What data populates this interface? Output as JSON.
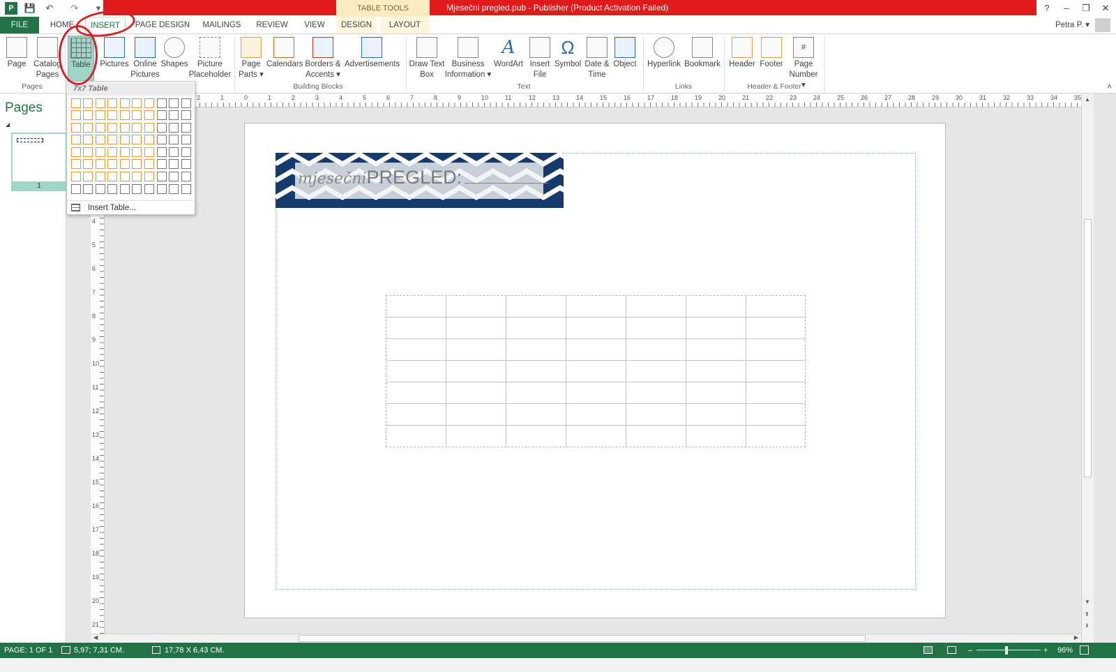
{
  "titlebar": {
    "contextual_tab": "TABLE TOOLS",
    "title": "Mjesečni pregled.pub -  Publisher (Product Activation Failed)",
    "help": "?",
    "minimize": "–",
    "restore": "❐",
    "close": "✕",
    "qat": {
      "app": "P",
      "save": "💾",
      "undo": "↶",
      "redo": "↷",
      "customize": "▾"
    }
  },
  "tabs": {
    "file": "FILE",
    "home": "HOME",
    "insert": "INSERT",
    "page_design": "PAGE DESIGN",
    "mailings": "MAILINGS",
    "review": "REVIEW",
    "view": "VIEW",
    "design": "DESIGN",
    "layout": "LAYOUT",
    "user": "Petra P. ▾"
  },
  "ribbon": {
    "page": "Page",
    "catalog_pages": "Catalog Pages",
    "table": "Table",
    "pictures": "Pictures",
    "online_pictures": "Online Pictures",
    "shapes": "Shapes",
    "picture_placeholder": "Picture Placeholder",
    "page_parts": "Page Parts ▾",
    "calendars": "Calendars",
    "borders_accents": "Borders & Accents ▾",
    "advertisements": "Advertisements",
    "draw_text_box": "Draw Text Box",
    "business_information": "Business Information ▾",
    "wordart": "WordArt",
    "insert_file": "Insert File",
    "symbol": "Symbol",
    "date_time": "Date & Time",
    "object": "Object",
    "hyperlink": "Hyperlink",
    "bookmark": "Bookmark",
    "header": "Header",
    "footer": "Footer",
    "page_number": "Page Number ▾",
    "groups": {
      "pages": "Pages",
      "building_blocks": "Building Blocks",
      "text": "Text",
      "links": "Links",
      "header_footer": "Header & Footer"
    },
    "collapse": "˄"
  },
  "left_pane": {
    "title": "Pages",
    "collapse": "◢",
    "thumb_number": "1"
  },
  "dropdown": {
    "header": "7x7 Table",
    "rows": 8,
    "cols": 10,
    "selected_rows": 7,
    "selected_cols": 7,
    "insert_table": "Insert Table..."
  },
  "document": {
    "banner_script": "mjesečni",
    "banner_text": "PREGLED:",
    "table_rows": 7,
    "table_cols": 7
  },
  "rulers": {
    "h": [
      "2",
      "1",
      "0",
      "1",
      "2",
      "3",
      "4",
      "5",
      "6",
      "7",
      "8",
      "9",
      "10",
      "11",
      "12",
      "13",
      "14",
      "15",
      "16",
      "17",
      "18",
      "19",
      "20",
      "21",
      "22",
      "23",
      "24",
      "25",
      "26",
      "27",
      "28",
      "29",
      "30",
      "31",
      "32",
      "33",
      "34",
      "35"
    ],
    "v": [
      "4",
      "5",
      "6",
      "7",
      "8",
      "9",
      "10",
      "11",
      "12",
      "13",
      "14",
      "15",
      "16",
      "17",
      "18",
      "19",
      "20",
      "21"
    ]
  },
  "status": {
    "page": "PAGE: 1 OF 1",
    "position": "5,97; 7,31 CM.",
    "size": "17,78 X  6,43 CM.",
    "zoom": "96%"
  },
  "colors": {
    "accent": "#217346",
    "titlebar_red": "#e0191b",
    "banner_navy": "#163a6b",
    "grid_highlight": "#e39b3c",
    "annotation": "#d9212a"
  }
}
